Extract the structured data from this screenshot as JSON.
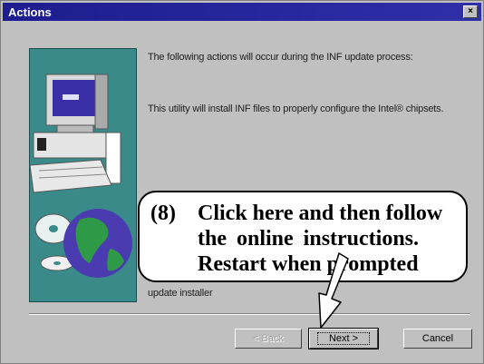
{
  "window": {
    "title": "Actions",
    "close_icon": "×"
  },
  "art": {
    "icon": "computer-with-cd-and-globe-icon"
  },
  "body": {
    "text1": "The following actions will occur during the INF update process:",
    "text2": "This utility will install INF files to properly configure the Intel® chipsets.",
    "text3": "update installer"
  },
  "buttons": {
    "back_label": "< Back",
    "next_label": "Next >",
    "cancel_label": "Cancel"
  },
  "callout": {
    "number": "(8)",
    "line1": "Click here and then follow",
    "line2": "the online instructions.",
    "line3": "Restart when prompted"
  },
  "colors": {
    "titlebar": "#1d1d8f",
    "panel": "#3a8a8a",
    "dialog": "#c0c0c0"
  }
}
